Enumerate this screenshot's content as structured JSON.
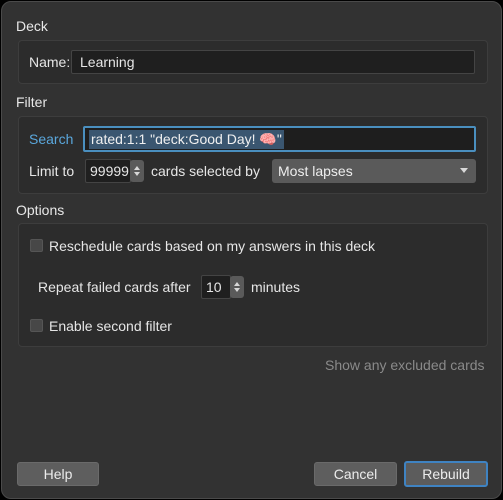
{
  "deck": {
    "section_title": "Deck",
    "name_label": "Name:",
    "name_value": "Learning"
  },
  "filter": {
    "section_title": "Filter",
    "search_label": "Search",
    "search_value": "rated:1:1 \"deck:Good Day! 🧠\"",
    "limit_label": "Limit to",
    "limit_value": "99999",
    "selected_by_label": "cards selected by",
    "order_value": "Most lapses"
  },
  "options": {
    "section_title": "Options",
    "reschedule_label": "Reschedule cards based on my answers in this deck",
    "repeat_label": "Repeat failed cards after",
    "repeat_value": "10",
    "minutes_label": "minutes",
    "second_filter_label": "Enable second filter"
  },
  "excluded_label": "Show any excluded cards",
  "buttons": {
    "help": "Help",
    "cancel": "Cancel",
    "rebuild": "Rebuild"
  },
  "colors": {
    "accent": "#3f83c2",
    "search_label": "#5aa7dc"
  }
}
